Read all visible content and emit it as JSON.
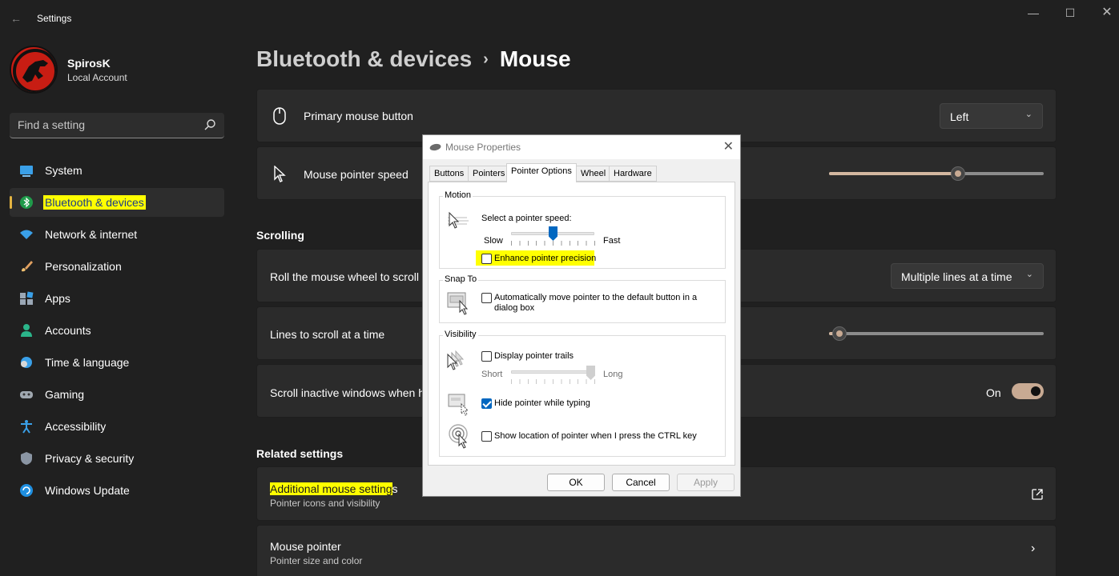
{
  "window": {
    "title": "Settings",
    "back_icon": "back-arrow-icon"
  },
  "user": {
    "name": "SpirosK",
    "account_type": "Local Account"
  },
  "search": {
    "placeholder": "Find a setting"
  },
  "nav": {
    "items": [
      {
        "label": "System",
        "icon": "monitor-icon"
      },
      {
        "label": "Bluetooth & devices",
        "icon": "bluetooth-icon",
        "selected": true
      },
      {
        "label": "Network & internet",
        "icon": "wifi-icon"
      },
      {
        "label": "Personalization",
        "icon": "brush-icon"
      },
      {
        "label": "Apps",
        "icon": "apps-icon"
      },
      {
        "label": "Accounts",
        "icon": "person-icon"
      },
      {
        "label": "Time & language",
        "icon": "globe-clock-icon"
      },
      {
        "label": "Gaming",
        "icon": "gamepad-icon"
      },
      {
        "label": "Accessibility",
        "icon": "accessibility-icon"
      },
      {
        "label": "Privacy & security",
        "icon": "shield-icon"
      },
      {
        "label": "Windows Update",
        "icon": "update-icon"
      }
    ]
  },
  "breadcrumb": {
    "parent": "Bluetooth & devices",
    "separator": "›",
    "current": "Mouse"
  },
  "main": {
    "primary_button": {
      "label": "Primary mouse button",
      "value": "Left"
    },
    "pointer_speed": {
      "label": "Mouse pointer speed",
      "level": 0.6
    },
    "scrolling_header": "Scrolling",
    "roll_wheel": {
      "label": "Roll the mouse wheel to scroll",
      "value": "Multiple lines at a time"
    },
    "lines_to_scroll": {
      "label": "Lines to scroll at a time",
      "level": 0.05
    },
    "scroll_inactive": {
      "label": "Scroll inactive windows when h",
      "state": "On"
    },
    "related_header": "Related settings",
    "additional": {
      "label_highlighted": "Additional mouse setting",
      "label_rest": "s",
      "sub": "Pointer icons and visibility"
    },
    "mouse_pointer": {
      "label": "Mouse pointer",
      "sub": "Pointer size and color"
    }
  },
  "dialog": {
    "title": "Mouse Properties",
    "tabs": [
      "Buttons",
      "Pointers",
      "Pointer Options",
      "Wheel",
      "Hardware"
    ],
    "active_tab": "Pointer Options",
    "motion": {
      "group": "Motion",
      "label": "Select a pointer speed:",
      "slow": "Slow",
      "fast": "Fast",
      "speed_level": 0.5,
      "enhance": "Enhance pointer precision",
      "enhance_checked": false
    },
    "snap": {
      "group": "Snap To",
      "label": "Automatically move pointer to the default button in a dialog box",
      "checked": false
    },
    "visibility": {
      "group": "Visibility",
      "trails": "Display pointer trails",
      "trails_checked": false,
      "short": "Short",
      "long": "Long",
      "hide": "Hide pointer while typing",
      "hide_checked": true,
      "ctrl": "Show location of pointer when I press the CTRL key",
      "ctrl_checked": false
    },
    "buttons": {
      "ok": "OK",
      "cancel": "Cancel",
      "apply": "Apply"
    }
  },
  "colors": {
    "accent": "#0067c0",
    "highlight": "#ffff00",
    "annotation": "#f26b1d",
    "slider_fill": "#d3b7a0"
  }
}
